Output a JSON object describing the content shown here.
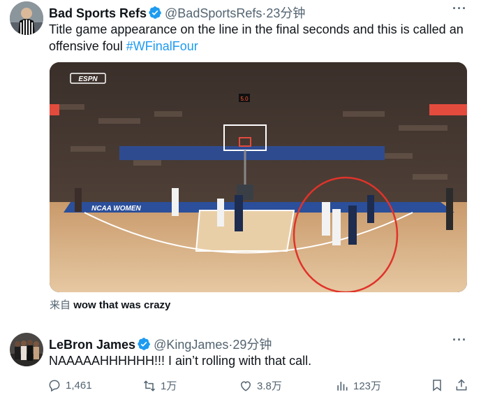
{
  "quoted": {
    "display_name": "Bad Sports Refs",
    "handle": "@BadSportsRefs",
    "separator": "·",
    "time": "23分钟",
    "text_main": "Title game appearance on the line in the final seconds and this is called an offensive foul",
    "hashtag": "#WFinalFour",
    "video": {
      "network_logo": "ESPN",
      "shot_clock": "5.0",
      "court_banner": "NCAA WOMEN",
      "highlight_color": "#e0332a"
    },
    "source_label": "来自",
    "source_text": "wow that was crazy"
  },
  "reply": {
    "display_name": "LeBron James",
    "handle": "@KingJames",
    "separator": "·",
    "time": "29分钟",
    "text": "NAAAAAHHHHHH!!! I ain’t rolling with that call."
  },
  "actions": {
    "replies": "1,461",
    "retweets": "1万",
    "likes": "3.8万",
    "views": "123万"
  },
  "icons": {
    "verified": "verified-badge-icon",
    "more": "more-options-icon",
    "reply": "reply-icon",
    "retweet": "retweet-icon",
    "like": "heart-icon",
    "views": "views-icon",
    "bookmark": "bookmark-icon",
    "share": "share-icon"
  },
  "colors": {
    "verified": "#1d9bf0",
    "hashtag": "#1d9bf0",
    "secondary_text": "#536471"
  }
}
